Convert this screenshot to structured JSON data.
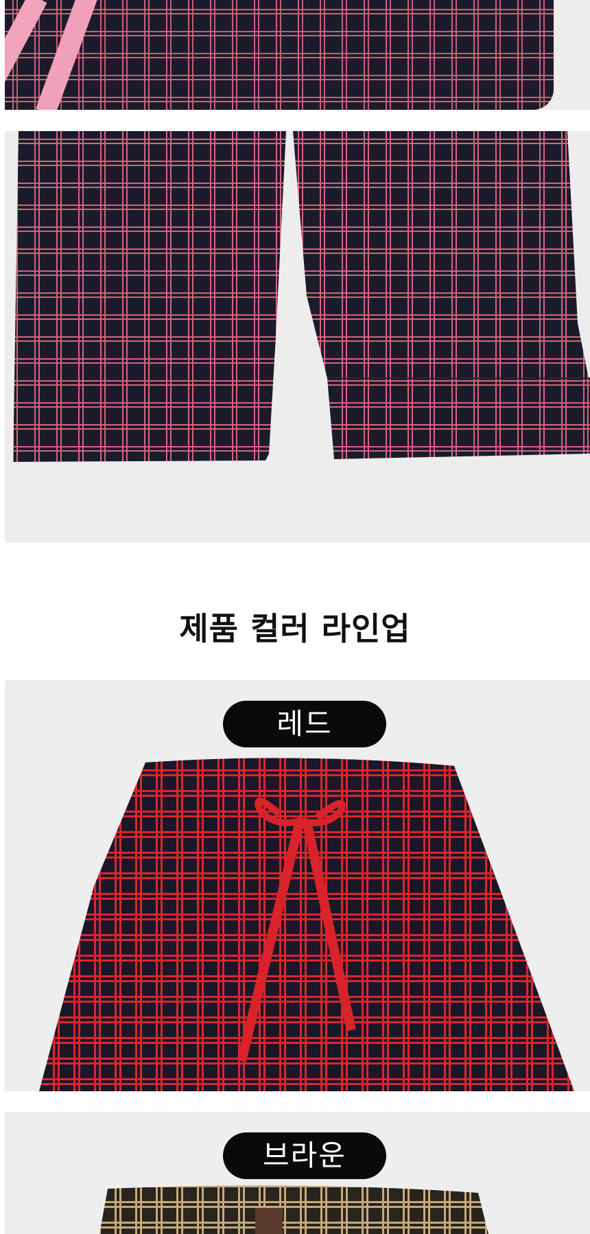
{
  "section_title": "제품 컬러 라인업",
  "colors": [
    {
      "label": "레드",
      "accent": "#d8232b"
    },
    {
      "label": "브라운",
      "accent": "#c8aa78"
    }
  ],
  "detail_accent": "#d6647e",
  "drawstring_pink": "#f2a4bd"
}
